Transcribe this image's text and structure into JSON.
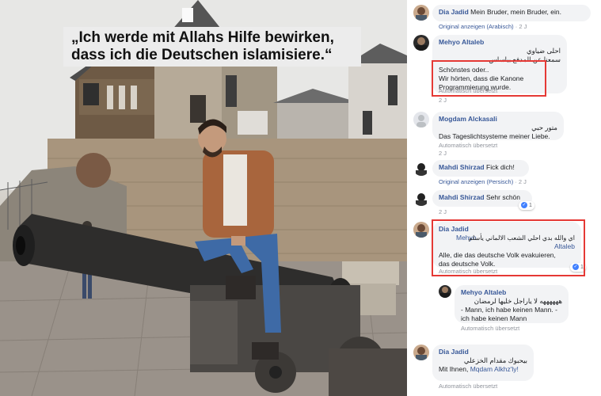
{
  "quote": {
    "line1": "„Ich werde mit Allahs Hilfe bewirken,",
    "line2": "dass ich die Deutschen islamisiere.“"
  },
  "comments": [
    {
      "name": "Dia Jadid",
      "text": "Mein Bruder, mein Bruder, ein.",
      "action": "Original anzeigen (Arabisch)",
      "time": "2 J"
    },
    {
      "name": "Mehyo Altaleb",
      "arabic_line1": "احلى ضياوي",
      "arabic_line2": "سمعنا عن المدفع بياساس",
      "translation_line1": "Schönstes oder..",
      "translation_line2": "Wir hörten, dass die Kanone",
      "translation_line3": "Programmierung wurde.",
      "meta": "Automatisch übersetzt",
      "time": "2 J"
    },
    {
      "name": "Mogdam Alckasali",
      "arabic": "متور حبي",
      "text": "Das Tageslichtsysteme meiner Liebe.",
      "meta": "Automatisch übersetzt",
      "time": "2 J"
    },
    {
      "name": "Mahdi Shirzad",
      "text": "Fick dich!",
      "action": "Original anzeigen (Persisch)",
      "time": "2 J"
    },
    {
      "name": "Mahdi Shirzad",
      "text": "Sehr schön",
      "time": "2 J",
      "likes": "1"
    },
    {
      "name": "Dia Jadid",
      "mention": "Mehyo Altaleb",
      "mention_line1": "Mehyo",
      "mention_line2": "Altaleb",
      "arabic": "اي والله بدي احلي الشعب الالماني يأسلم",
      "translation_line1": "Alle, die das deutsche Volk evakuieren,",
      "translation_line2": "das deutsche Volk.",
      "meta": "Automatisch übersetzt",
      "likes": "1"
    },
    {
      "name": "Mehyo Altaleb",
      "arabic": "ههههههه لا ياراجل خليها لرمضان",
      "translation_line1": "- Mann, ich habe keinen Mann. -",
      "translation_line2": "ich habe keinen Mann",
      "meta": "Automatisch übersetzt"
    },
    {
      "name": "Dia Jadid",
      "arabic": "بيحبوك مقدام الخزعلي",
      "text_prefix": "Mit Ihnen,",
      "mention": "Mqdam Alkhz'ly!",
      "meta": "Automatisch übersetzt"
    }
  ],
  "colors": {
    "name": "#385898",
    "bubble": "#f2f3f5",
    "highlight_box": "#e53935",
    "meta": "#90949c",
    "like": "#4080ff"
  },
  "icons": {
    "like": "thumbs-up-icon"
  }
}
